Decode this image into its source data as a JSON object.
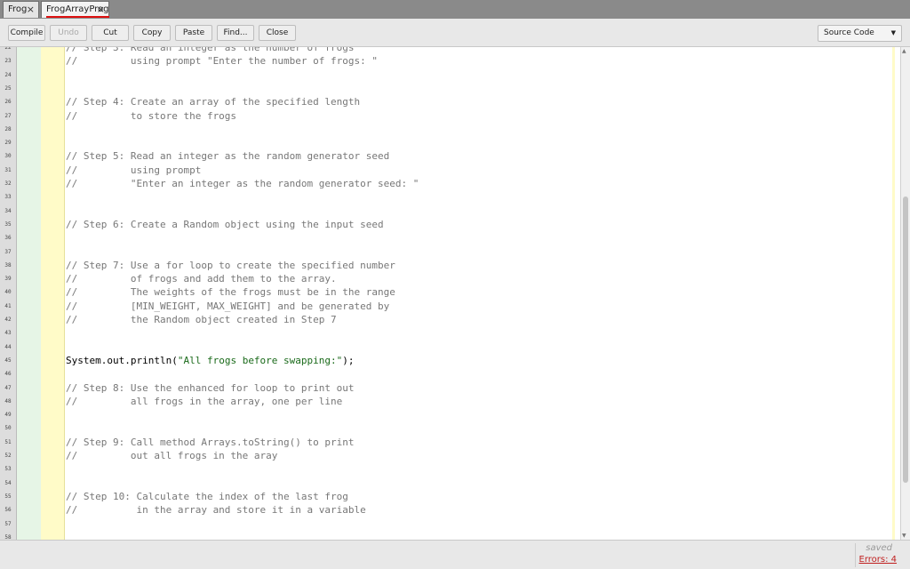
{
  "tabs": [
    {
      "label": "Frog",
      "active": false
    },
    {
      "label": "FrogArrayProg",
      "active": true
    }
  ],
  "tab_close_glyph": "×",
  "toolbar": {
    "compile": "Compile",
    "undo": "Undo",
    "cut": "Cut",
    "copy": "Copy",
    "paste": "Paste",
    "find": "Find...",
    "close": "Close",
    "view_select": "Source Code"
  },
  "editor": {
    "lines": [
      {
        "n": "22",
        "text": "// Step 3: Read an integer as the number of frogs"
      },
      {
        "n": "23",
        "text": "//         using prompt \"Enter the number of frogs: \""
      },
      {
        "n": "24",
        "text": ""
      },
      {
        "n": "25",
        "text": ""
      },
      {
        "n": "26",
        "text": "// Step 4: Create an array of the specified length"
      },
      {
        "n": "27",
        "text": "//         to store the frogs"
      },
      {
        "n": "28",
        "text": ""
      },
      {
        "n": "29",
        "text": ""
      },
      {
        "n": "30",
        "text": "// Step 5: Read an integer as the random generator seed"
      },
      {
        "n": "31",
        "text": "//         using prompt"
      },
      {
        "n": "32",
        "text": "//         \"Enter an integer as the random generator seed: \""
      },
      {
        "n": "33",
        "text": ""
      },
      {
        "n": "34",
        "text": ""
      },
      {
        "n": "35",
        "text": "// Step 6: Create a Random object using the input seed"
      },
      {
        "n": "36",
        "text": ""
      },
      {
        "n": "37",
        "text": ""
      },
      {
        "n": "38",
        "text": "// Step 7: Use a for loop to create the specified number"
      },
      {
        "n": "39",
        "text": "//         of frogs and add them to the array."
      },
      {
        "n": "40",
        "text": "//         The weights of the frogs must be in the range"
      },
      {
        "n": "41",
        "text": "//         [MIN_WEIGHT, MAX_WEIGHT] and be generated by"
      },
      {
        "n": "42",
        "text": "//         the Random object created in Step 7"
      },
      {
        "n": "43",
        "text": ""
      },
      {
        "n": "44",
        "text": ""
      },
      {
        "n": "45",
        "code": "System.out.println(",
        "str": "\"All frogs before swapping:\"",
        "tail": ");"
      },
      {
        "n": "46",
        "text": ""
      },
      {
        "n": "47",
        "text": "// Step 8: Use the enhanced for loop to print out"
      },
      {
        "n": "48",
        "text": "//         all frogs in the array, one per line"
      },
      {
        "n": "49",
        "text": ""
      },
      {
        "n": "50",
        "text": ""
      },
      {
        "n": "51",
        "text": "// Step 9: Call method Arrays.toString() to print"
      },
      {
        "n": "52",
        "text": "//         out all frogs in the aray"
      },
      {
        "n": "53",
        "text": ""
      },
      {
        "n": "54",
        "text": ""
      },
      {
        "n": "55",
        "text": "// Step 10: Calculate the index of the last frog"
      },
      {
        "n": "56",
        "text": "//          in the array and store it in a variable"
      },
      {
        "n": "57",
        "text": ""
      },
      {
        "n": "58",
        "text": ""
      }
    ]
  },
  "status": {
    "saved": "saved",
    "errors": "Errors: 4"
  }
}
